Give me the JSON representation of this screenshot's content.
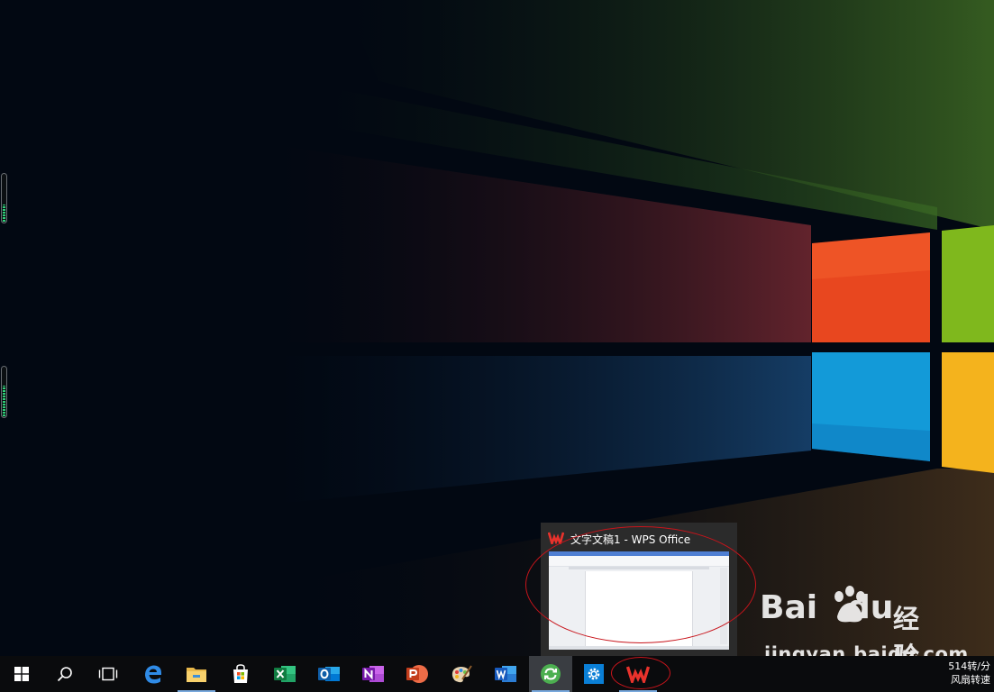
{
  "preview": {
    "title": "文字文稿1 - WPS Office",
    "app_icon": "wps-icon"
  },
  "taskbar": {
    "items": [
      {
        "name": "start-button",
        "icon": "windows-logo-icon"
      },
      {
        "name": "search-button",
        "icon": "search-icon"
      },
      {
        "name": "task-view-button",
        "icon": "task-view-icon"
      },
      {
        "name": "edge-button",
        "icon": "edge-icon"
      },
      {
        "name": "file-explorer-button",
        "icon": "folder-icon"
      },
      {
        "name": "store-button",
        "icon": "store-icon"
      },
      {
        "name": "excel-button",
        "icon": "excel-icon"
      },
      {
        "name": "outlook-button",
        "icon": "outlook-icon"
      },
      {
        "name": "onenote-button",
        "icon": "onenote-icon"
      },
      {
        "name": "powerpoint-button",
        "icon": "powerpoint-icon"
      },
      {
        "name": "paint-button",
        "icon": "paint-palette-icon"
      },
      {
        "name": "word-button",
        "icon": "word-icon"
      },
      {
        "name": "refresh-app-button",
        "icon": "refresh-icon"
      },
      {
        "name": "settings-button",
        "icon": "gear-icon"
      },
      {
        "name": "wps-button",
        "icon": "wps-icon"
      }
    ],
    "tray": {
      "speed": "514转/分",
      "label": "风扇转速"
    }
  },
  "watermark": {
    "brand_left": "Bai",
    "brand_right": "du",
    "brand_cn": "经验",
    "url": "jingyan.baidu.com"
  },
  "edge_widgets": {
    "upper_level": 0.35,
    "lower_level": 0.6
  },
  "colors": {
    "wallpaper_red": "#e8471f",
    "wallpaper_green": "#7fb81d",
    "wallpaper_blue": "#139ad8",
    "wallpaper_yellow": "#f4b31d",
    "annotation": "#c8141b",
    "taskbar_bg": "#0a0b0d"
  }
}
